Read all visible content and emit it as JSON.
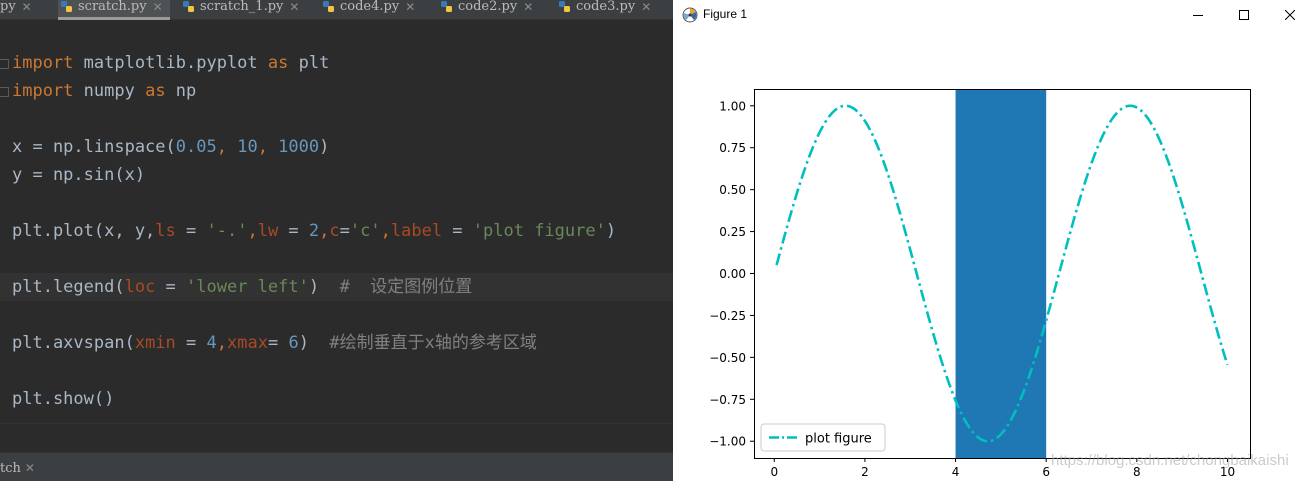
{
  "ide": {
    "tabs": [
      {
        "label": "py",
        "close": "✕",
        "icon": false,
        "active": false
      },
      {
        "label": "scratch.py",
        "close": "✕",
        "icon": true,
        "active": true
      },
      {
        "label": "scratch_1.py",
        "close": "✕",
        "icon": true,
        "active": false
      },
      {
        "label": "code4.py",
        "close": "✕",
        "icon": true,
        "active": false
      },
      {
        "label": "code2.py",
        "close": "✕",
        "icon": true,
        "active": false
      },
      {
        "label": "code3.py",
        "close": "✕",
        "icon": true,
        "active": false
      }
    ],
    "code": {
      "l1": {
        "kw1": "import",
        "mod": " matplotlib.pyplot ",
        "kw2": "as",
        "alias": " plt"
      },
      "l2": {
        "kw1": "import",
        "mod": " numpy ",
        "kw2": "as",
        "alias": " np"
      },
      "l3": {
        "a": "x = np.linspace(",
        "n1": "0.05",
        "c1": ", ",
        "n2": "10",
        "c2": ", ",
        "n3": "1000",
        "b": ")"
      },
      "l4": {
        "text": "y = np.sin(x)"
      },
      "l5": {
        "a": "plt.plot(x, y,",
        "p1": "ls",
        "e1": " = ",
        "s1": "'-.'",
        "c1": ",",
        "p2": "lw",
        "e2": " = ",
        "n1": "2",
        "c2": ",",
        "p3": "c",
        "e3": "=",
        "s3": "'c'",
        "c3": ",",
        "p4": "label",
        "e4": " = ",
        "s4": "'plot figure'",
        "b": ")"
      },
      "l6": {
        "a": "plt.legend(",
        "p1": "loc",
        "e1": " = ",
        "s1": "'lower left'",
        "b": ")  ",
        "cmt": "#  设定图例位置"
      },
      "l7": {
        "a": "plt.axvspan(",
        "p1": "xmin",
        "e1": " = ",
        "n1": "4",
        "c1": ",",
        "p2": "xmax",
        "e2": "= ",
        "n2": "6",
        "b": ")  ",
        "cmt": "#绘制垂直于x轴的参考区域"
      },
      "l8": {
        "text": "plt.show()"
      }
    },
    "bottom_tab": {
      "label": "tch",
      "close": "✕"
    }
  },
  "figure": {
    "title": "Figure 1",
    "watermark": "https://blog.csdn.net/chongbaikaishi",
    "colors": {
      "line": "#00bfbf",
      "span": "#1f77b4"
    }
  },
  "chart_data": {
    "type": "line",
    "title": "",
    "xlabel": "",
    "ylabel": "",
    "xlim": [
      -0.4475,
      10.4975
    ],
    "ylim": [
      -1.1,
      1.1
    ],
    "x_ticks": [
      0,
      2,
      4,
      6,
      8,
      10
    ],
    "y_ticks": [
      -1.0,
      -0.75,
      -0.5,
      -0.25,
      0.0,
      0.25,
      0.5,
      0.75,
      1.0
    ],
    "x_tick_labels": [
      "0",
      "2",
      "4",
      "6",
      "8",
      "10"
    ],
    "y_tick_labels": [
      "−1.00",
      "−0.75",
      "−0.50",
      "−0.25",
      "0.00",
      "0.25",
      "0.50",
      "0.75",
      "1.00"
    ],
    "series": [
      {
        "name": "plot figure",
        "function": "sin(x)",
        "x_range": [
          0.05,
          10
        ],
        "n_points": 1000,
        "linestyle": "-.",
        "linewidth": 2,
        "color": "#00bfbf"
      }
    ],
    "axvspan": {
      "xmin": 4,
      "xmax": 6,
      "color": "#1f77b4"
    },
    "legend": {
      "loc": "lower left",
      "entries": [
        "plot figure"
      ]
    },
    "grid": false
  }
}
